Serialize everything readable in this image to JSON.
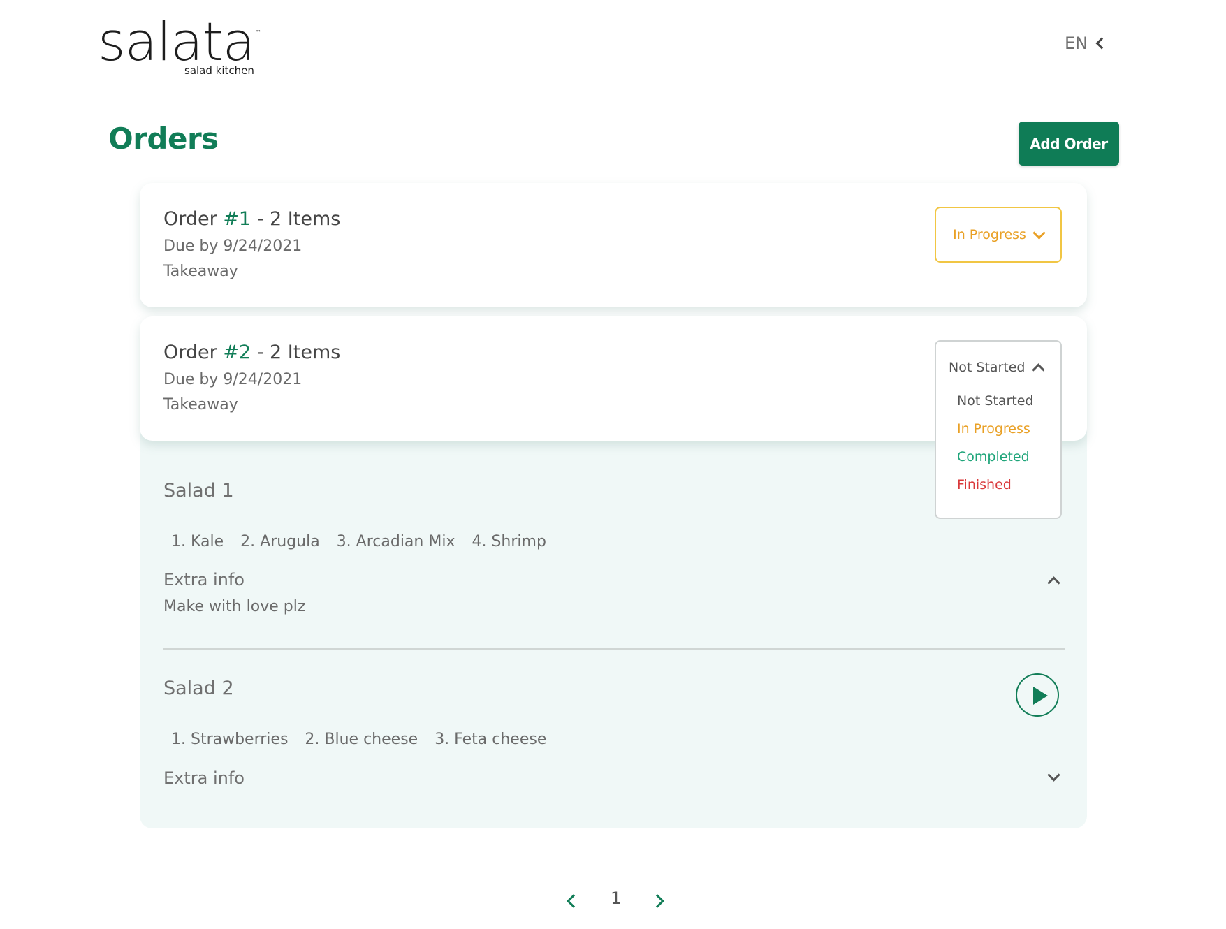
{
  "header": {
    "logo_word": "salata",
    "logo_tm": "™",
    "logo_sub": "salad kitchen",
    "language": "EN"
  },
  "page": {
    "title": "Orders",
    "add_order_label": "Add Order"
  },
  "orders": [
    {
      "title_prefix": "Order ",
      "number": "#1",
      "title_suffix": " - 2 Items",
      "due": "Due by 9/24/2021",
      "type": "Takeaway",
      "status": "In Progress"
    },
    {
      "title_prefix": "Order ",
      "number": "#2",
      "title_suffix": " - 2 Items",
      "due": "Due by 9/24/2021",
      "type": "Takeaway",
      "status": "Not Started",
      "salads": [
        {
          "name": "Salad 1",
          "ingredients": [
            "1. Kale",
            "2. Arugula",
            "3. Arcadian Mix",
            "4. Shrimp"
          ],
          "extra_label": "Extra info",
          "extra_text": "Make with love plz"
        },
        {
          "name": "Salad 2",
          "ingredients": [
            "1. Strawberries",
            "2. Blue cheese",
            "3. Feta cheese"
          ],
          "extra_label": "Extra info"
        }
      ]
    }
  ],
  "status_options": [
    {
      "label": "Not Started",
      "color": "#555555"
    },
    {
      "label": "In Progress",
      "color": "#e9a025"
    },
    {
      "label": "Completed",
      "color": "#1fa57a"
    },
    {
      "label": "Finished",
      "color": "#d9393b"
    }
  ],
  "pagination": {
    "current": "1"
  },
  "colors": {
    "brand_green": "#117d57",
    "in_progress": "#e9a025",
    "expanded_bg": "#f0f8f7"
  }
}
